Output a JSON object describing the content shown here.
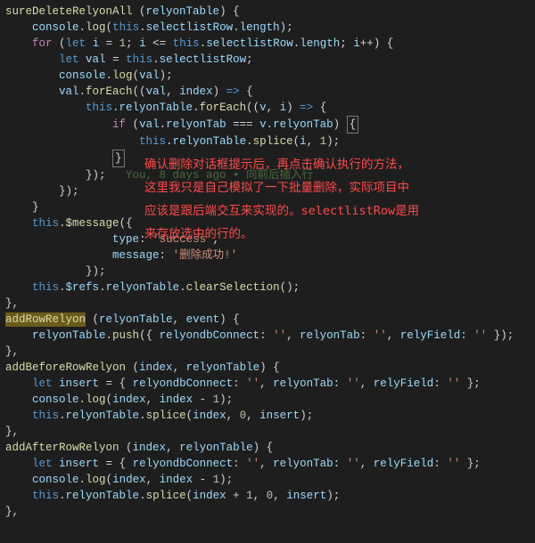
{
  "code": {
    "lines": [
      {
        "indent": 0,
        "segs": [
          {
            "c": "fn",
            "t": "sureDeleteRelyonAll"
          },
          {
            "c": "op",
            "t": " ("
          },
          {
            "c": "pr",
            "t": "relyonTable"
          },
          {
            "c": "op",
            "t": ") {"
          }
        ]
      },
      {
        "indent": 1,
        "segs": [
          {
            "c": "pr",
            "t": "console"
          },
          {
            "c": "op",
            "t": "."
          },
          {
            "c": "fn",
            "t": "log"
          },
          {
            "c": "op",
            "t": "("
          },
          {
            "c": "kw",
            "t": "this"
          },
          {
            "c": "op",
            "t": "."
          },
          {
            "c": "pr",
            "t": "selectlistRow"
          },
          {
            "c": "op",
            "t": "."
          },
          {
            "c": "pr",
            "t": "length"
          },
          {
            "c": "op",
            "t": ");"
          }
        ]
      },
      {
        "indent": 1,
        "segs": [
          {
            "c": "kw2",
            "t": "for"
          },
          {
            "c": "op",
            "t": " ("
          },
          {
            "c": "kw",
            "t": "let"
          },
          {
            "c": "op",
            "t": " "
          },
          {
            "c": "pr",
            "t": "i"
          },
          {
            "c": "op",
            "t": " = "
          },
          {
            "c": "nm",
            "t": "1"
          },
          {
            "c": "op",
            "t": "; "
          },
          {
            "c": "pr",
            "t": "i"
          },
          {
            "c": "op",
            "t": " <= "
          },
          {
            "c": "kw",
            "t": "this"
          },
          {
            "c": "op",
            "t": "."
          },
          {
            "c": "pr",
            "t": "selectlistRow"
          },
          {
            "c": "op",
            "t": "."
          },
          {
            "c": "pr",
            "t": "length"
          },
          {
            "c": "op",
            "t": "; "
          },
          {
            "c": "pr",
            "t": "i"
          },
          {
            "c": "op",
            "t": "++) {"
          }
        ]
      },
      {
        "indent": 2,
        "segs": [
          {
            "c": "kw",
            "t": "let"
          },
          {
            "c": "op",
            "t": " "
          },
          {
            "c": "pr",
            "t": "val"
          },
          {
            "c": "op",
            "t": " = "
          },
          {
            "c": "kw",
            "t": "this"
          },
          {
            "c": "op",
            "t": "."
          },
          {
            "c": "pr",
            "t": "selectlistRow"
          },
          {
            "c": "op",
            "t": ";"
          }
        ]
      },
      {
        "indent": 2,
        "segs": [
          {
            "c": "pr",
            "t": "console"
          },
          {
            "c": "op",
            "t": "."
          },
          {
            "c": "fn",
            "t": "log"
          },
          {
            "c": "op",
            "t": "("
          },
          {
            "c": "pr",
            "t": "val"
          },
          {
            "c": "op",
            "t": ");"
          }
        ]
      },
      {
        "indent": 2,
        "segs": [
          {
            "c": "pr",
            "t": "val"
          },
          {
            "c": "op",
            "t": "."
          },
          {
            "c": "fn",
            "t": "forEach"
          },
          {
            "c": "op",
            "t": "(("
          },
          {
            "c": "pr",
            "t": "val"
          },
          {
            "c": "op",
            "t": ", "
          },
          {
            "c": "pr",
            "t": "index"
          },
          {
            "c": "op",
            "t": ") "
          },
          {
            "c": "kw",
            "t": "=>"
          },
          {
            "c": "op",
            "t": " {"
          }
        ]
      },
      {
        "indent": 3,
        "segs": [
          {
            "c": "kw",
            "t": "this"
          },
          {
            "c": "op",
            "t": "."
          },
          {
            "c": "pr",
            "t": "relyonTable"
          },
          {
            "c": "op",
            "t": "."
          },
          {
            "c": "fn",
            "t": "forEach"
          },
          {
            "c": "op",
            "t": "(("
          },
          {
            "c": "pr",
            "t": "v"
          },
          {
            "c": "op",
            "t": ", "
          },
          {
            "c": "pr",
            "t": "i"
          },
          {
            "c": "op",
            "t": ") "
          },
          {
            "c": "kw",
            "t": "=>"
          },
          {
            "c": "op",
            "t": " {"
          }
        ]
      },
      {
        "indent": 4,
        "segs": [
          {
            "c": "kw2",
            "t": "if"
          },
          {
            "c": "op",
            "t": " ("
          },
          {
            "c": "pr",
            "t": "val"
          },
          {
            "c": "op",
            "t": "."
          },
          {
            "c": "pr",
            "t": "relyonTab"
          },
          {
            "c": "op",
            "t": " === "
          },
          {
            "c": "pr",
            "t": "v"
          },
          {
            "c": "op",
            "t": "."
          },
          {
            "c": "pr",
            "t": "relyonTab"
          },
          {
            "c": "op",
            "t": ") "
          },
          {
            "c": "box",
            "t": "{"
          }
        ]
      },
      {
        "indent": 5,
        "segs": [
          {
            "c": "kw",
            "t": "this"
          },
          {
            "c": "op",
            "t": "."
          },
          {
            "c": "pr",
            "t": "relyonTable"
          },
          {
            "c": "op",
            "t": "."
          },
          {
            "c": "fn",
            "t": "splice"
          },
          {
            "c": "op",
            "t": "("
          },
          {
            "c": "pr",
            "t": "i"
          },
          {
            "c": "op",
            "t": ", "
          },
          {
            "c": "nm",
            "t": "1"
          },
          {
            "c": "op",
            "t": ");"
          }
        ]
      },
      {
        "indent": 4,
        "segs": [
          {
            "c": "box",
            "t": "}"
          }
        ]
      },
      {
        "indent": 3,
        "segs": [
          {
            "c": "op",
            "t": "});   "
          },
          {
            "c": "cm",
            "t": "You, 8 days ago • 向前后插入行"
          }
        ]
      },
      {
        "indent": 2,
        "segs": [
          {
            "c": "op",
            "t": "});"
          }
        ]
      },
      {
        "indent": 1,
        "segs": [
          {
            "c": "pc",
            "t": "}"
          }
        ]
      },
      {
        "indent": 1,
        "segs": [
          {
            "c": "kw",
            "t": "this"
          },
          {
            "c": "op",
            "t": "."
          },
          {
            "c": "fn",
            "t": "$message"
          },
          {
            "c": "op",
            "t": "({"
          }
        ]
      },
      {
        "indent": 4,
        "segs": [
          {
            "c": "pr",
            "t": "type"
          },
          {
            "c": "op",
            "t": ": "
          },
          {
            "c": "st",
            "t": "'success'"
          },
          {
            "c": "op",
            "t": ","
          }
        ]
      },
      {
        "indent": 4,
        "segs": [
          {
            "c": "pr",
            "t": "message"
          },
          {
            "c": "op",
            "t": ": "
          },
          {
            "c": "st",
            "t": "'删除成功!'"
          }
        ]
      },
      {
        "indent": 3,
        "segs": [
          {
            "c": "op",
            "t": "});"
          }
        ]
      },
      {
        "indent": 1,
        "segs": [
          {
            "c": "kw",
            "t": "this"
          },
          {
            "c": "op",
            "t": "."
          },
          {
            "c": "pr",
            "t": "$refs"
          },
          {
            "c": "op",
            "t": "."
          },
          {
            "c": "pr",
            "t": "relyonTable"
          },
          {
            "c": "op",
            "t": "."
          },
          {
            "c": "fn",
            "t": "clearSelection"
          },
          {
            "c": "op",
            "t": "();"
          }
        ]
      },
      {
        "indent": 0,
        "segs": [
          {
            "c": "op",
            "t": "},"
          }
        ]
      },
      {
        "indent": 0,
        "segs": [
          {
            "c": "hl fn",
            "t": "addRowRelyon"
          },
          {
            "c": "op",
            "t": " ("
          },
          {
            "c": "pr",
            "t": "relyonTable"
          },
          {
            "c": "op",
            "t": ", "
          },
          {
            "c": "pr",
            "t": "event"
          },
          {
            "c": "op",
            "t": ") {"
          }
        ]
      },
      {
        "indent": 1,
        "segs": [
          {
            "c": "pr",
            "t": "relyonTable"
          },
          {
            "c": "op",
            "t": "."
          },
          {
            "c": "fn",
            "t": "push"
          },
          {
            "c": "op",
            "t": "({ "
          },
          {
            "c": "pr",
            "t": "relyondbConnect"
          },
          {
            "c": "op",
            "t": ": "
          },
          {
            "c": "st",
            "t": "''"
          },
          {
            "c": "op",
            "t": ", "
          },
          {
            "c": "pr",
            "t": "relyonTab"
          },
          {
            "c": "op",
            "t": ": "
          },
          {
            "c": "st",
            "t": "''"
          },
          {
            "c": "op",
            "t": ", "
          },
          {
            "c": "pr",
            "t": "relyField"
          },
          {
            "c": "op",
            "t": ": "
          },
          {
            "c": "st",
            "t": "''"
          },
          {
            "c": "op",
            "t": " });"
          }
        ]
      },
      {
        "indent": 0,
        "segs": [
          {
            "c": "op",
            "t": "},"
          }
        ]
      },
      {
        "indent": 0,
        "segs": [
          {
            "c": "fn",
            "t": "addBeforeRowRelyon"
          },
          {
            "c": "op",
            "t": " ("
          },
          {
            "c": "pr",
            "t": "index"
          },
          {
            "c": "op",
            "t": ", "
          },
          {
            "c": "pr",
            "t": "relyonTable"
          },
          {
            "c": "op",
            "t": ") {"
          }
        ]
      },
      {
        "indent": 1,
        "segs": [
          {
            "c": "kw",
            "t": "let"
          },
          {
            "c": "op",
            "t": " "
          },
          {
            "c": "pr",
            "t": "insert"
          },
          {
            "c": "op",
            "t": " = { "
          },
          {
            "c": "pr",
            "t": "relyondbConnect"
          },
          {
            "c": "op",
            "t": ": "
          },
          {
            "c": "st",
            "t": "''"
          },
          {
            "c": "op",
            "t": ", "
          },
          {
            "c": "pr",
            "t": "relyonTab"
          },
          {
            "c": "op",
            "t": ": "
          },
          {
            "c": "st",
            "t": "''"
          },
          {
            "c": "op",
            "t": ", "
          },
          {
            "c": "pr",
            "t": "relyField"
          },
          {
            "c": "op",
            "t": ": "
          },
          {
            "c": "st",
            "t": "''"
          },
          {
            "c": "op",
            "t": " };"
          }
        ]
      },
      {
        "indent": 1,
        "segs": [
          {
            "c": "pr",
            "t": "console"
          },
          {
            "c": "op",
            "t": "."
          },
          {
            "c": "fn",
            "t": "log"
          },
          {
            "c": "op",
            "t": "("
          },
          {
            "c": "pr",
            "t": "index"
          },
          {
            "c": "op",
            "t": ", "
          },
          {
            "c": "pr",
            "t": "index"
          },
          {
            "c": "op",
            "t": " - "
          },
          {
            "c": "nm",
            "t": "1"
          },
          {
            "c": "op",
            "t": ");"
          }
        ]
      },
      {
        "indent": 1,
        "segs": [
          {
            "c": "kw",
            "t": "this"
          },
          {
            "c": "op",
            "t": "."
          },
          {
            "c": "pr",
            "t": "relyonTable"
          },
          {
            "c": "op",
            "t": "."
          },
          {
            "c": "fn",
            "t": "splice"
          },
          {
            "c": "op",
            "t": "("
          },
          {
            "c": "pr",
            "t": "index"
          },
          {
            "c": "op",
            "t": ", "
          },
          {
            "c": "nm",
            "t": "0"
          },
          {
            "c": "op",
            "t": ", "
          },
          {
            "c": "pr",
            "t": "insert"
          },
          {
            "c": "op",
            "t": ");"
          }
        ]
      },
      {
        "indent": 0,
        "segs": [
          {
            "c": "op",
            "t": "},"
          }
        ]
      },
      {
        "indent": 0,
        "segs": [
          {
            "c": "fn",
            "t": "addAfterRowRelyon"
          },
          {
            "c": "op",
            "t": " ("
          },
          {
            "c": "pr",
            "t": "index"
          },
          {
            "c": "op",
            "t": ", "
          },
          {
            "c": "pr",
            "t": "relyonTable"
          },
          {
            "c": "op",
            "t": ") {"
          }
        ]
      },
      {
        "indent": 1,
        "segs": [
          {
            "c": "kw",
            "t": "let"
          },
          {
            "c": "op",
            "t": " "
          },
          {
            "c": "pr",
            "t": "insert"
          },
          {
            "c": "op",
            "t": " = { "
          },
          {
            "c": "pr",
            "t": "relyondbConnect"
          },
          {
            "c": "op",
            "t": ": "
          },
          {
            "c": "st",
            "t": "''"
          },
          {
            "c": "op",
            "t": ", "
          },
          {
            "c": "pr",
            "t": "relyonTab"
          },
          {
            "c": "op",
            "t": ": "
          },
          {
            "c": "st",
            "t": "''"
          },
          {
            "c": "op",
            "t": ", "
          },
          {
            "c": "pr",
            "t": "relyField"
          },
          {
            "c": "op",
            "t": ": "
          },
          {
            "c": "st",
            "t": "''"
          },
          {
            "c": "op",
            "t": " };"
          }
        ]
      },
      {
        "indent": 1,
        "segs": [
          {
            "c": "pr",
            "t": "console"
          },
          {
            "c": "op",
            "t": "."
          },
          {
            "c": "fn",
            "t": "log"
          },
          {
            "c": "op",
            "t": "("
          },
          {
            "c": "pr",
            "t": "index"
          },
          {
            "c": "op",
            "t": ", "
          },
          {
            "c": "pr",
            "t": "index"
          },
          {
            "c": "op",
            "t": " - "
          },
          {
            "c": "nm",
            "t": "1"
          },
          {
            "c": "op",
            "t": ");"
          }
        ]
      },
      {
        "indent": 1,
        "segs": [
          {
            "c": "kw",
            "t": "this"
          },
          {
            "c": "op",
            "t": "."
          },
          {
            "c": "pr",
            "t": "relyonTable"
          },
          {
            "c": "op",
            "t": "."
          },
          {
            "c": "fn",
            "t": "splice"
          },
          {
            "c": "op",
            "t": "("
          },
          {
            "c": "pr",
            "t": "index"
          },
          {
            "c": "op",
            "t": " + "
          },
          {
            "c": "nm",
            "t": "1"
          },
          {
            "c": "op",
            "t": ", "
          },
          {
            "c": "nm",
            "t": "0"
          },
          {
            "c": "op",
            "t": ", "
          },
          {
            "c": "pr",
            "t": "insert"
          },
          {
            "c": "op",
            "t": ");"
          }
        ]
      },
      {
        "indent": 0,
        "segs": [
          {
            "c": "op",
            "t": "},"
          }
        ]
      }
    ],
    "indent_unit": "    "
  },
  "annotation": {
    "lines": [
      "确认删除对话框提示后，再点击确认执行的方法，",
      "这里我只是自己模拟了一下批量删除，实际项目中",
      "应该是跟后端交互来实现的。selectlistRow是用",
      "来存放选中的行的。"
    ]
  }
}
